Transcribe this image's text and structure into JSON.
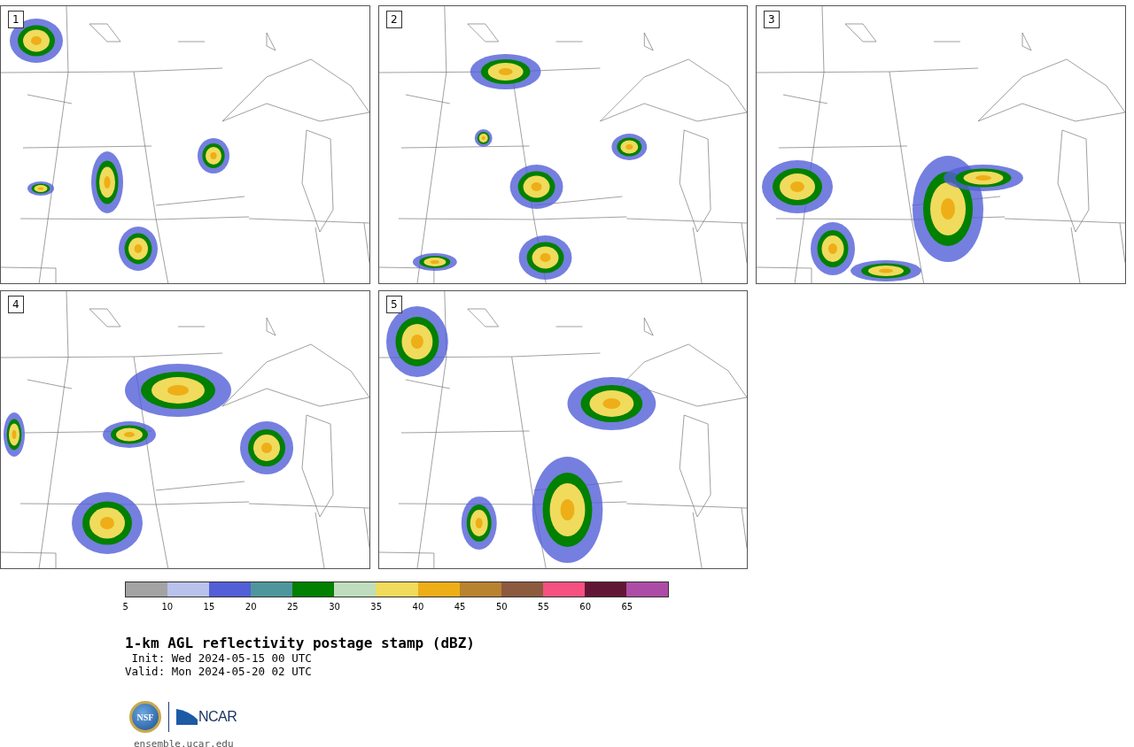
{
  "panels": [
    {
      "label": "1"
    },
    {
      "label": "2"
    },
    {
      "label": "3"
    },
    {
      "label": "4"
    },
    {
      "label": "5"
    }
  ],
  "colorbar": {
    "items": [
      {
        "color": "#a3a3a3",
        "tick": "5"
      },
      {
        "color": "#b8c2ec",
        "tick": "10"
      },
      {
        "color": "#525fd7",
        "tick": "15"
      },
      {
        "color": "#4f969c",
        "tick": "20"
      },
      {
        "color": "#028001",
        "tick": "25"
      },
      {
        "color": "#bfddbd",
        "tick": "30"
      },
      {
        "color": "#f0db5c",
        "tick": "35"
      },
      {
        "color": "#eeae17",
        "tick": "40"
      },
      {
        "color": "#b9822f",
        "tick": "45"
      },
      {
        "color": "#8c5a3e",
        "tick": "50"
      },
      {
        "color": "#f45180",
        "tick": "55"
      },
      {
        "color": "#621635",
        "tick": "60"
      },
      {
        "color": "#ad4ca6",
        "tick": "65"
      }
    ]
  },
  "title": "1-km AGL reflectivity postage stamp (dBZ)",
  "init": " Init: Wed 2024-05-15 00 UTC",
  "valid": "Valid: Mon 2024-05-20 02 UTC",
  "logo": {
    "left": "NSF",
    "right": "NCAR"
  },
  "footer": "ensemble.ucar.edu"
}
